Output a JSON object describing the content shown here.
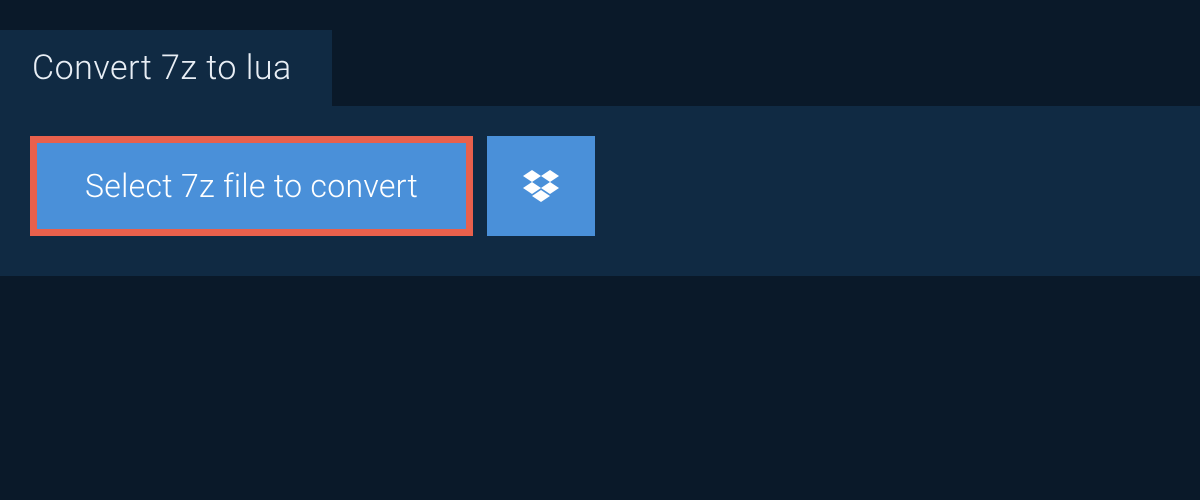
{
  "tab": {
    "title": "Convert 7z to lua"
  },
  "actions": {
    "select_file_label": "Select 7z file to convert"
  }
}
